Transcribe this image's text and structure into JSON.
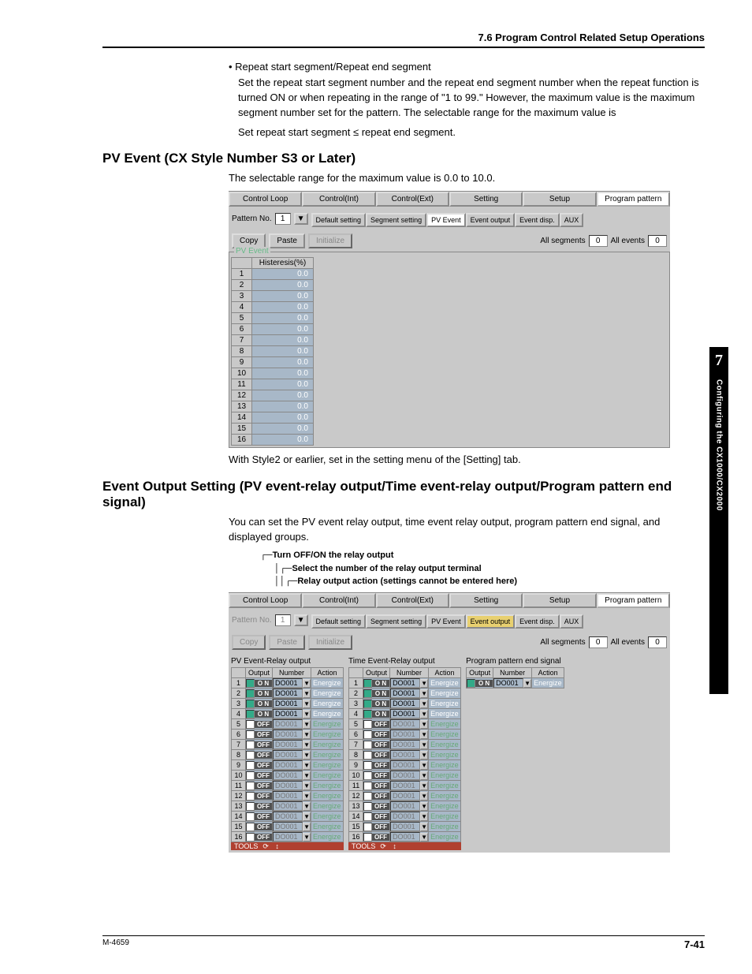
{
  "header": {
    "section": "7.6  Program Control Related Setup Operations"
  },
  "intro": {
    "bullet": "•   Repeat start segment/Repeat end segment",
    "p1": "Set the repeat start segment number and the repeat end segment number when the repeat function is turned ON or when repeating in the range of \"1 to 99.\"  However, the maximum value is the maximum segment number set for the pattern. The selectable range for the maximum value is",
    "p2": "Set repeat start segment ≤ repeat end segment."
  },
  "sec1": {
    "heading": "PV Event (CX Style Number S3 or Later)",
    "text": "The selectable range for the maximum value is 0.0 to 10.0.",
    "note": "With Style2 or earlier, set in the setting menu of the [Setting] tab."
  },
  "sec2": {
    "heading": "Event Output Setting (PV event-relay output/Time event-relay output/Program pattern end signal)",
    "text": "You can set the PV event relay output, time event relay output, program pattern end signal, and displayed groups."
  },
  "legend": {
    "l1": "Turn OFF/ON the relay output",
    "l2": "Select the number of the relay output terminal",
    "l3": "Relay output action (settings cannot be entered here)"
  },
  "tabs": {
    "top": [
      "Control Loop",
      "Control(Int)",
      "Control(Ext)",
      "Setting",
      "Setup",
      "Program pattern"
    ],
    "sub": [
      "Default setting",
      "Segment setting",
      "PV Event",
      "Event output",
      "Event disp.",
      "AUX"
    ]
  },
  "ctrl": {
    "patternLabel": "Pattern No.",
    "patternVal": "1",
    "copy": "Copy",
    "paste": "Paste",
    "init": "Initialize",
    "allSeg": "All segments",
    "allSegVal": "0",
    "allEvt": "All events",
    "allEvtVal": "0"
  },
  "hyst": {
    "group": "PV Event",
    "header": "Histeresis(%)",
    "rows": [
      {
        "n": "1",
        "v": "0.0"
      },
      {
        "n": "2",
        "v": "0.0"
      },
      {
        "n": "3",
        "v": "0.0"
      },
      {
        "n": "4",
        "v": "0.0"
      },
      {
        "n": "5",
        "v": "0.0"
      },
      {
        "n": "6",
        "v": "0.0"
      },
      {
        "n": "7",
        "v": "0.0"
      },
      {
        "n": "8",
        "v": "0.0"
      },
      {
        "n": "9",
        "v": "0.0"
      },
      {
        "n": "10",
        "v": "0.0"
      },
      {
        "n": "11",
        "v": "0.0"
      },
      {
        "n": "12",
        "v": "0.0"
      },
      {
        "n": "13",
        "v": "0.0"
      },
      {
        "n": "14",
        "v": "0.0"
      },
      {
        "n": "15",
        "v": "0.0"
      },
      {
        "n": "16",
        "v": "0.0"
      }
    ]
  },
  "evt": {
    "titles": {
      "pv": "PV Event-Relay output",
      "te": "Time Event-Relay output",
      "pe": "Program pattern end signal"
    },
    "cols": {
      "output": "Output",
      "number": "Number",
      "action": "Action"
    },
    "tools": "TOOLS",
    "pv": [
      {
        "n": "1",
        "on": true,
        "num": "DO001",
        "act": "Energize"
      },
      {
        "n": "2",
        "on": true,
        "num": "DO001",
        "act": "Energize"
      },
      {
        "n": "3",
        "on": true,
        "num": "DO001",
        "act": "Energize"
      },
      {
        "n": "4",
        "on": true,
        "num": "DO001",
        "act": "Energize"
      },
      {
        "n": "5",
        "on": false,
        "num": "DO001",
        "act": "Energize"
      },
      {
        "n": "6",
        "on": false,
        "num": "DO001",
        "act": "Energize"
      },
      {
        "n": "7",
        "on": false,
        "num": "DO001",
        "act": "Energize"
      },
      {
        "n": "8",
        "on": false,
        "num": "DO001",
        "act": "Energize"
      },
      {
        "n": "9",
        "on": false,
        "num": "DO001",
        "act": "Energize"
      },
      {
        "n": "10",
        "on": false,
        "num": "DO001",
        "act": "Energize"
      },
      {
        "n": "11",
        "on": false,
        "num": "DO001",
        "act": "Energize"
      },
      {
        "n": "12",
        "on": false,
        "num": "DO001",
        "act": "Energize"
      },
      {
        "n": "13",
        "on": false,
        "num": "DO001",
        "act": "Energize"
      },
      {
        "n": "14",
        "on": false,
        "num": "DO001",
        "act": "Energize"
      },
      {
        "n": "15",
        "on": false,
        "num": "DO001",
        "act": "Energize"
      },
      {
        "n": "16",
        "on": false,
        "num": "DO001",
        "act": "Energize"
      }
    ],
    "te": [
      {
        "n": "1",
        "on": true,
        "num": "DO001",
        "act": "Energize"
      },
      {
        "n": "2",
        "on": true,
        "num": "DO001",
        "act": "Energize"
      },
      {
        "n": "3",
        "on": true,
        "num": "DO001",
        "act": "Energize"
      },
      {
        "n": "4",
        "on": true,
        "num": "DO001",
        "act": "Energize"
      },
      {
        "n": "5",
        "on": false,
        "num": "DO001",
        "act": "Energize"
      },
      {
        "n": "6",
        "on": false,
        "num": "DO001",
        "act": "Energize"
      },
      {
        "n": "7",
        "on": false,
        "num": "DO001",
        "act": "Energize"
      },
      {
        "n": "8",
        "on": false,
        "num": "DO001",
        "act": "Energize"
      },
      {
        "n": "9",
        "on": false,
        "num": "DO001",
        "act": "Energize"
      },
      {
        "n": "10",
        "on": false,
        "num": "DO001",
        "act": "Energize"
      },
      {
        "n": "11",
        "on": false,
        "num": "DO001",
        "act": "Energize"
      },
      {
        "n": "12",
        "on": false,
        "num": "DO001",
        "act": "Energize"
      },
      {
        "n": "13",
        "on": false,
        "num": "DO001",
        "act": "Energize"
      },
      {
        "n": "14",
        "on": false,
        "num": "DO001",
        "act": "Energize"
      },
      {
        "n": "15",
        "on": false,
        "num": "DO001",
        "act": "Energize"
      },
      {
        "n": "16",
        "on": false,
        "num": "DO001",
        "act": "Energize"
      }
    ],
    "pe": [
      {
        "n": "",
        "on": true,
        "num": "DO001",
        "act": "Energize"
      }
    ]
  },
  "side": {
    "num": "7",
    "text": "Configuring the CX1000/CX2000"
  },
  "footer": {
    "left": "M-4659",
    "right": "7-41"
  },
  "labels": {
    "on": "O N",
    "off": "OFF"
  }
}
